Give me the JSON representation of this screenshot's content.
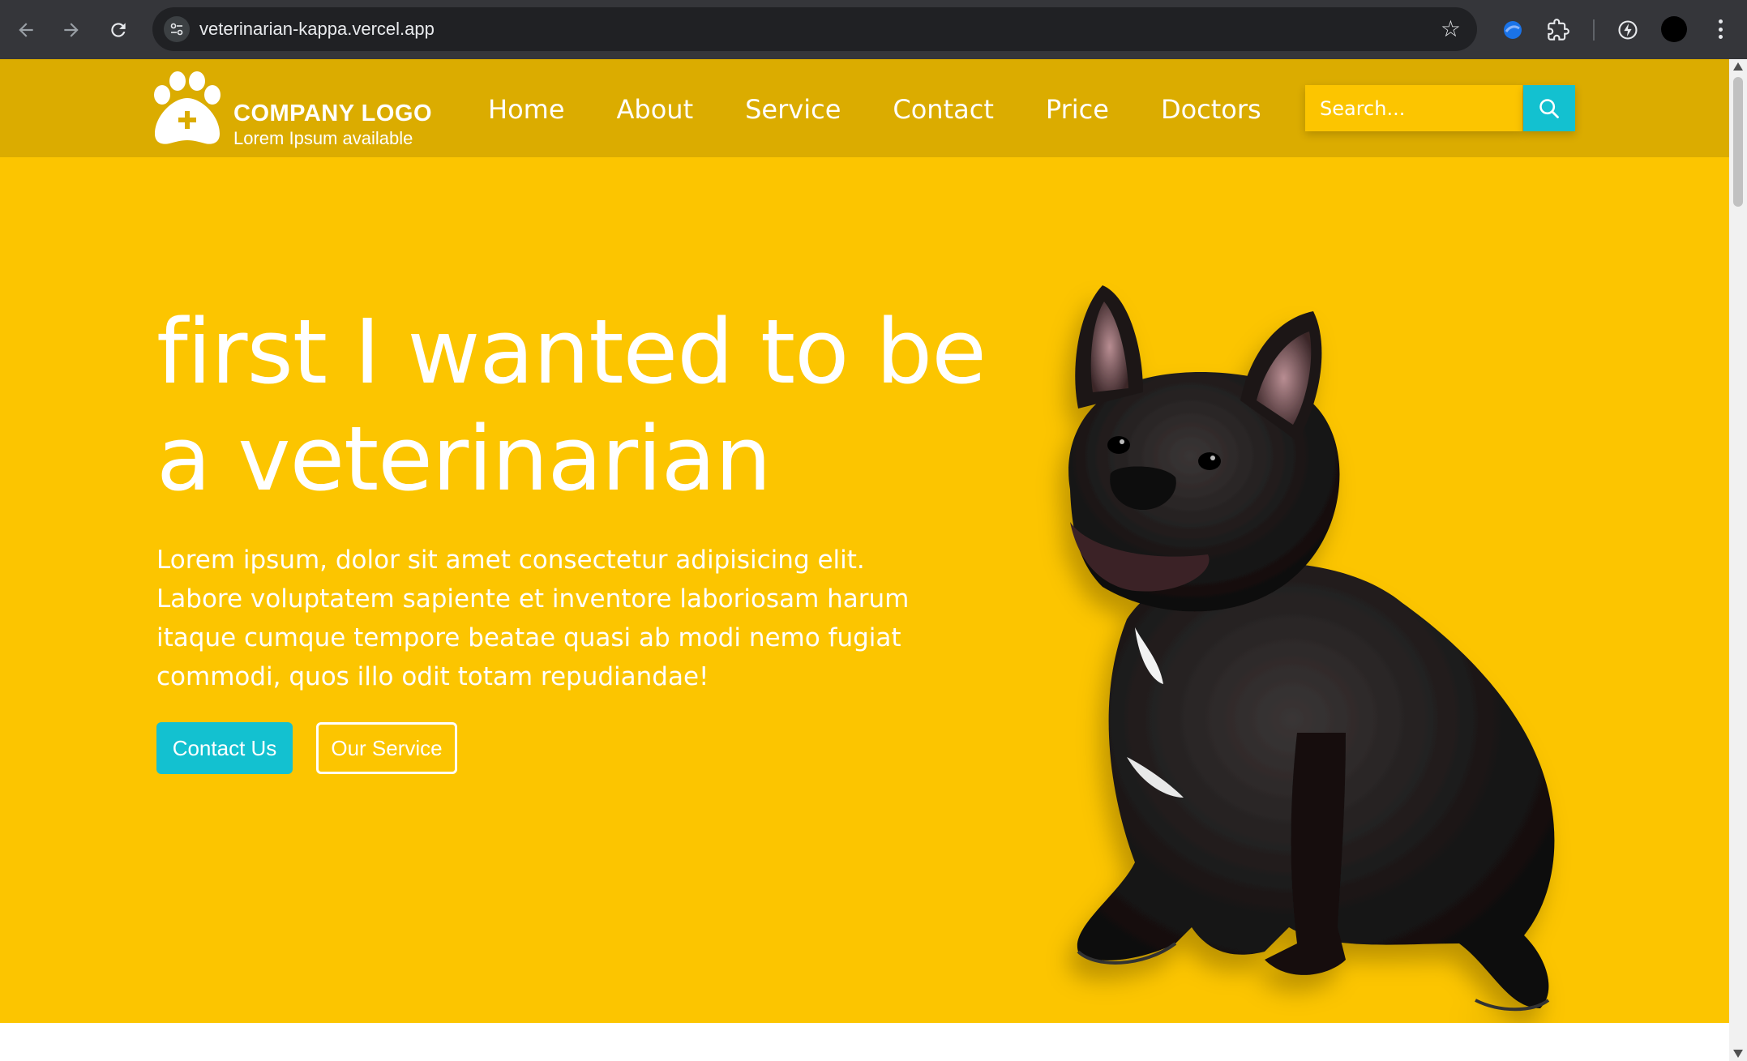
{
  "browser": {
    "url": "veterinarian-kappa.vercel.app"
  },
  "header": {
    "logo_title": "COMPANY LOGO",
    "logo_subtitle": "Lorem Ipsum available",
    "menu": [
      {
        "label": "Home"
      },
      {
        "label": "About"
      },
      {
        "label": "Service"
      },
      {
        "label": "Contact"
      },
      {
        "label": "Price"
      },
      {
        "label": "Doctors"
      }
    ],
    "search_placeholder": "Search..."
  },
  "hero": {
    "title_line1": "first I wanted to be",
    "title_line2": "a veterinarian",
    "text": "Lorem ipsum, dolor sit amet consectetur adipisicing elit. Labore voluptatem sapiente et inventore laboriosam harum itaque cumque tempore beatae quasi ab modi nemo fugiat commodi, quos illo odit totam repudiandae!",
    "contact_button": "Contact Us",
    "service_button": "Our Service"
  },
  "colors": {
    "header_bg": "#dbac00",
    "hero_bg": "#fcc500",
    "accent": "#13c1d0",
    "text": "#ffffff"
  },
  "icons": {
    "logo": "paw-plus-icon",
    "search": "search-icon",
    "hero_image": "french-bulldog-photo"
  }
}
